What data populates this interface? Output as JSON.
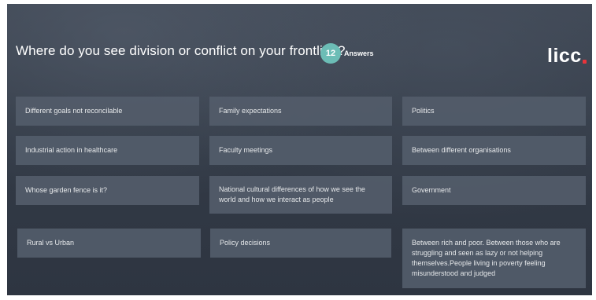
{
  "question": {
    "title": "Where do you see division or conflict on your frontline?",
    "answer_count": "12",
    "answers_label": "Answers"
  },
  "brand": {
    "logo_text": "licc",
    "accent_color": "#e8343b",
    "badge_color": "#6cbdb6"
  },
  "answers": [
    "Different goals not reconcilable",
    "Family expectations",
    "Politics",
    "Industrial action in healthcare",
    "Faculty meetings",
    "Between different organisations",
    "Whose garden fence is it?",
    "National cultural differences of how we see the world and how we interact as people",
    "Government",
    "Rural vs Urban",
    "Policy decisions",
    "Between rich and poor. Between those who are struggling and seen as lazy or not helping themselves.People living in poverty feeling misunderstood and judged"
  ]
}
